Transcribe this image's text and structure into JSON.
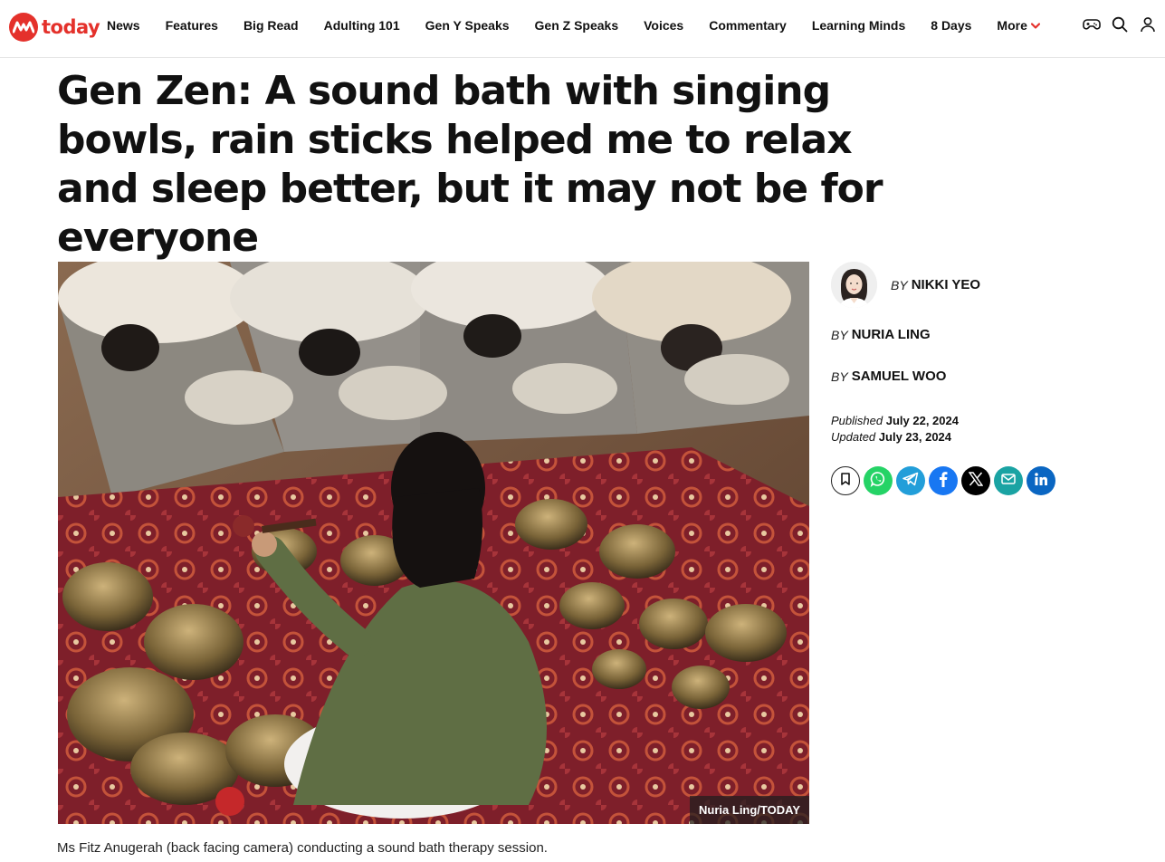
{
  "brand": {
    "name": "today",
    "color": "#e4312b"
  },
  "nav": {
    "items": [
      "News",
      "Features",
      "Big Read",
      "Adulting 101",
      "Gen Y Speaks",
      "Gen Z Speaks",
      "Voices",
      "Commentary",
      "Learning Minds",
      "8 Days"
    ],
    "more_label": "More"
  },
  "header_icons": [
    "gamepad-icon",
    "search-icon",
    "user-icon"
  ],
  "article": {
    "headline": "Gen Zen: A sound bath with singing bowls, rain sticks helped me to relax and sleep better, but it may not be for everyone",
    "image_credit": "Nuria Ling/TODAY",
    "caption": "Ms Fitz Anugerah (back facing camera) conducting a sound bath therapy session.",
    "by_label": "BY",
    "authors": [
      "NIKKI YEO",
      "NURIA LING",
      "SAMUEL WOO"
    ],
    "published_label": "Published",
    "published_date": "July 22, 2024",
    "updated_label": "Updated",
    "updated_date": "July 23, 2024"
  },
  "share": [
    {
      "icon": "bookmark-icon",
      "color": "#ffffff"
    },
    {
      "icon": "whatsapp-icon",
      "color": "#25d366"
    },
    {
      "icon": "telegram-icon",
      "color": "#229ed9"
    },
    {
      "icon": "facebook-icon",
      "color": "#1877f2"
    },
    {
      "icon": "x-icon",
      "color": "#000000"
    },
    {
      "icon": "email-icon",
      "color": "#1aa3a3"
    },
    {
      "icon": "linkedin-icon",
      "color": "#0a66c2"
    }
  ]
}
